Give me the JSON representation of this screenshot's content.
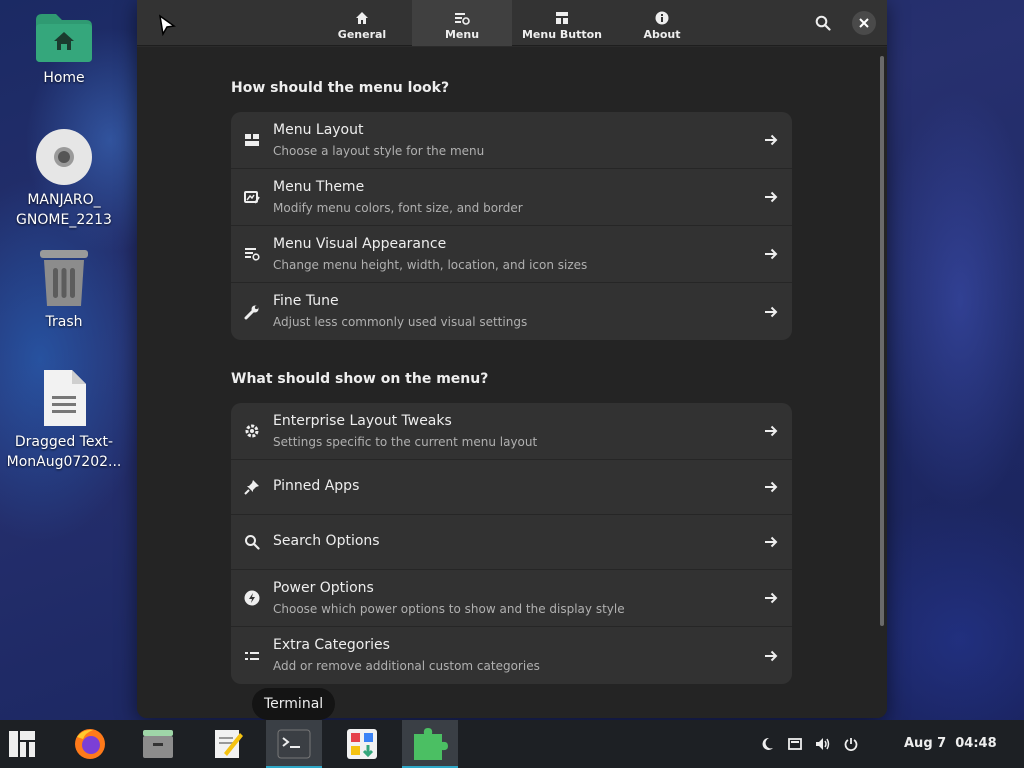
{
  "desktop": {
    "icons": [
      {
        "label": "Home"
      },
      {
        "label": "MANJARO_\nGNOME_2213"
      },
      {
        "label": "Trash"
      },
      {
        "label": "Dragged Text-\nMonAug07202..."
      }
    ]
  },
  "window": {
    "tabs": [
      {
        "label": "General",
        "icon": "home-icon"
      },
      {
        "label": "Menu",
        "icon": "menu-settings-icon"
      },
      {
        "label": "Menu Button",
        "icon": "menu-button-icon"
      },
      {
        "label": "About",
        "icon": "info-icon"
      }
    ],
    "active_tab": "Menu",
    "sections": [
      {
        "title": "How should the menu look?",
        "rows": [
          {
            "title": "Menu Layout",
            "subtitle": "Choose a layout style for the menu",
            "icon": "layout-icon"
          },
          {
            "title": "Menu Theme",
            "subtitle": "Modify menu colors, font size, and border",
            "icon": "theme-icon"
          },
          {
            "title": "Menu Visual Appearance",
            "subtitle": "Change menu height, width, location, and icon sizes",
            "icon": "appearance-icon"
          },
          {
            "title": "Fine Tune",
            "subtitle": "Adjust less commonly used visual settings",
            "icon": "wrench-icon"
          }
        ]
      },
      {
        "title": "What should show on the menu?",
        "rows": [
          {
            "title": "Enterprise Layout Tweaks",
            "subtitle": "Settings specific to the current menu layout",
            "icon": "gear-icon"
          },
          {
            "title": "Pinned Apps",
            "subtitle": "",
            "icon": "pin-icon"
          },
          {
            "title": "Search Options",
            "subtitle": "",
            "icon": "search-icon"
          },
          {
            "title": "Power Options",
            "subtitle": "Choose which power options to show and the display style",
            "icon": "power-bolt-icon"
          },
          {
            "title": "Extra Categories",
            "subtitle": "Add or remove additional custom categories",
            "icon": "categories-icon"
          }
        ]
      }
    ]
  },
  "tooltip": "Terminal",
  "taskbar": {
    "apps": [
      "manjaro-menu-icon",
      "firefox-icon",
      "file-manager-icon",
      "text-editor-icon",
      "terminal-icon",
      "software-icon",
      "extensions-icon"
    ],
    "clock_date": "Aug 7",
    "clock_time": "04:48"
  },
  "colors": {
    "accent": "#2fa8c8",
    "folder_green": "#35a77c",
    "window_bg": "#242424",
    "row_bg": "#323232"
  }
}
